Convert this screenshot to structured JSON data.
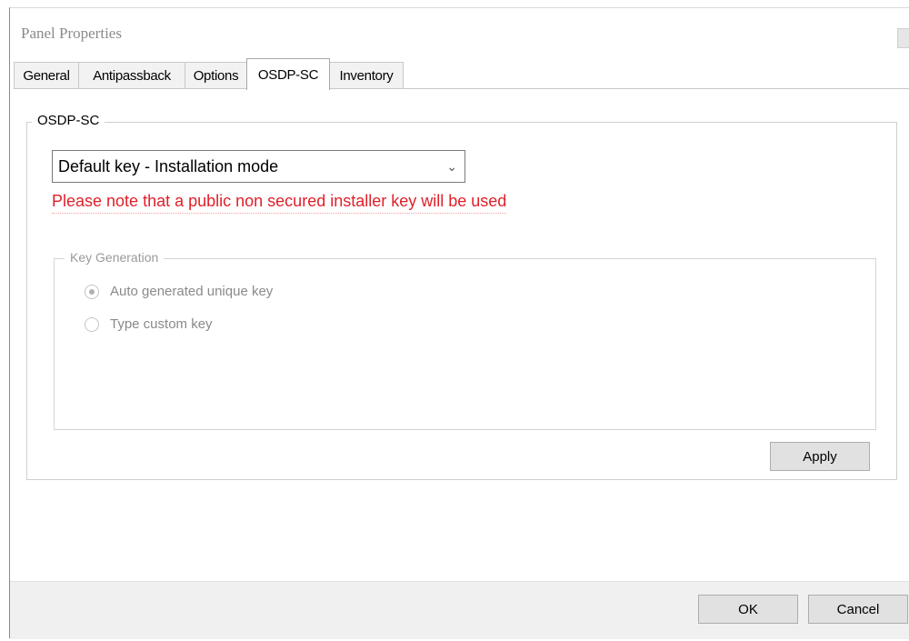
{
  "window": {
    "title": "Panel Properties"
  },
  "tabs": [
    {
      "label": "General"
    },
    {
      "label": "Antipassback"
    },
    {
      "label": "Options"
    },
    {
      "label": "OSDP-SC",
      "active": true
    },
    {
      "label": "Inventory"
    }
  ],
  "osdp": {
    "group_title": "OSDP-SC",
    "mode_select": {
      "value": "Default key - Installation mode",
      "icon": "chevron-down-icon"
    },
    "warning": "Please note that a public non secured installer key will be used",
    "warning_color": "#e0202a",
    "key_generation": {
      "title": "Key Generation",
      "disabled": true,
      "options": [
        {
          "label": "Auto generated unique key",
          "checked": true
        },
        {
          "label": "Type custom key",
          "checked": false
        }
      ]
    },
    "apply_label": "Apply"
  },
  "footer": {
    "ok_label": "OK",
    "cancel_label": "Cancel"
  }
}
